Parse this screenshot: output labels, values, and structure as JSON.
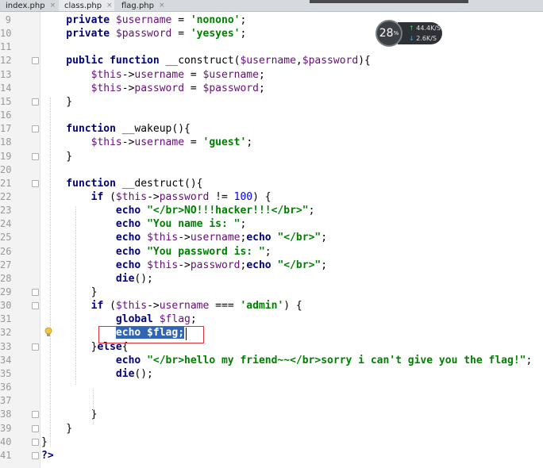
{
  "tabs": [
    {
      "label": "index.php",
      "active": false
    },
    {
      "label": "class.php",
      "active": true
    },
    {
      "label": "flag.php",
      "active": false
    }
  ],
  "close_glyph": "×",
  "widget": {
    "cpu": "28",
    "cpu_unit": "%",
    "up_arrow": "↑",
    "up_speed": "44.4",
    "up_unit": "K/S",
    "down_arrow": "↓",
    "down_speed": "2.6",
    "down_unit": "K/S"
  },
  "colors": {
    "keyword": "#000080",
    "variable": "#660e7a",
    "string": "#008000",
    "number": "#0000ff",
    "selection": "#2f64b6",
    "highlight_box": "#e0303a"
  },
  "lines": [
    {
      "n": "9",
      "segs": [
        [
          "k",
          "    private "
        ],
        [
          "v",
          "$username"
        ],
        [
          "p",
          " = "
        ],
        [
          "s",
          "'nonono'"
        ],
        [
          "p",
          ";"
        ]
      ]
    },
    {
      "n": "10",
      "segs": [
        [
          "k",
          "    private "
        ],
        [
          "v",
          "$password"
        ],
        [
          "p",
          " = "
        ],
        [
          "s",
          "'yesyes'"
        ],
        [
          "p",
          ";"
        ]
      ]
    },
    {
      "n": "11",
      "segs": []
    },
    {
      "n": "12",
      "segs": [
        [
          "k",
          "    public function "
        ],
        [
          "p",
          "__construct("
        ],
        [
          "v",
          "$username"
        ],
        [
          "p",
          ","
        ],
        [
          "v",
          "$password"
        ],
        [
          "p",
          "){"
        ]
      ]
    },
    {
      "n": "13",
      "segs": [
        [
          "v",
          "        $this"
        ],
        [
          "p",
          "->"
        ],
        [
          "v",
          "username"
        ],
        [
          "p",
          " = "
        ],
        [
          "v",
          "$username"
        ],
        [
          "p",
          ";"
        ]
      ]
    },
    {
      "n": "14",
      "segs": [
        [
          "v",
          "        $this"
        ],
        [
          "p",
          "->"
        ],
        [
          "v",
          "password"
        ],
        [
          "p",
          " = "
        ],
        [
          "v",
          "$password"
        ],
        [
          "p",
          ";"
        ]
      ]
    },
    {
      "n": "15",
      "segs": [
        [
          "p",
          "    }"
        ]
      ]
    },
    {
      "n": "16",
      "segs": []
    },
    {
      "n": "17",
      "segs": [
        [
          "k",
          "    function "
        ],
        [
          "p",
          "__wakeup(){"
        ]
      ]
    },
    {
      "n": "18",
      "segs": [
        [
          "v",
          "        $this"
        ],
        [
          "p",
          "->"
        ],
        [
          "v",
          "username"
        ],
        [
          "p",
          " = "
        ],
        [
          "s",
          "'guest'"
        ],
        [
          "p",
          ";"
        ]
      ]
    },
    {
      "n": "19",
      "segs": [
        [
          "p",
          "    }"
        ]
      ]
    },
    {
      "n": "20",
      "segs": []
    },
    {
      "n": "21",
      "segs": [
        [
          "k",
          "    function "
        ],
        [
          "p",
          "__destruct(){"
        ]
      ]
    },
    {
      "n": "22",
      "segs": [
        [
          "k",
          "        if "
        ],
        [
          "p",
          "("
        ],
        [
          "v",
          "$this"
        ],
        [
          "p",
          "->"
        ],
        [
          "v",
          "password"
        ],
        [
          "p",
          " != "
        ],
        [
          "n",
          "100"
        ],
        [
          "p",
          ") {"
        ]
      ]
    },
    {
      "n": "23",
      "segs": [
        [
          "k",
          "            echo "
        ],
        [
          "s",
          "\"</br>NO!!!hacker!!!</br>\""
        ],
        [
          "p",
          ";"
        ]
      ]
    },
    {
      "n": "24",
      "segs": [
        [
          "k",
          "            echo "
        ],
        [
          "s",
          "\"You name is: \""
        ],
        [
          "p",
          ";"
        ]
      ]
    },
    {
      "n": "25",
      "segs": [
        [
          "k",
          "            echo "
        ],
        [
          "v",
          "$this"
        ],
        [
          "p",
          "->"
        ],
        [
          "v",
          "username"
        ],
        [
          "p",
          ";"
        ],
        [
          "k",
          "echo "
        ],
        [
          "s",
          "\"</br>\""
        ],
        [
          "p",
          ";"
        ]
      ]
    },
    {
      "n": "26",
      "segs": [
        [
          "k",
          "            echo "
        ],
        [
          "s",
          "\"You password is: \""
        ],
        [
          "p",
          ";"
        ]
      ]
    },
    {
      "n": "27",
      "segs": [
        [
          "k",
          "            echo "
        ],
        [
          "v",
          "$this"
        ],
        [
          "p",
          "->"
        ],
        [
          "v",
          "password"
        ],
        [
          "p",
          ";"
        ],
        [
          "k",
          "echo "
        ],
        [
          "s",
          "\"</br>\""
        ],
        [
          "p",
          ";"
        ]
      ]
    },
    {
      "n": "28",
      "segs": [
        [
          "k",
          "            die"
        ],
        [
          "p",
          "();"
        ]
      ]
    },
    {
      "n": "29",
      "segs": [
        [
          "p",
          "        }"
        ]
      ]
    },
    {
      "n": "30",
      "segs": [
        [
          "k",
          "        if "
        ],
        [
          "p",
          "("
        ],
        [
          "v",
          "$this"
        ],
        [
          "p",
          "->"
        ],
        [
          "v",
          "username"
        ],
        [
          "p",
          " === "
        ],
        [
          "s",
          "'admin'"
        ],
        [
          "p",
          ") {"
        ]
      ]
    },
    {
      "n": "31",
      "segs": [
        [
          "k",
          "            global "
        ],
        [
          "v",
          "$flag"
        ],
        [
          "p",
          ";"
        ]
      ]
    },
    {
      "n": "32",
      "segs": [
        [
          "p",
          "            "
        ],
        [
          "hl",
          "echo $flag;"
        ]
      ]
    },
    {
      "n": "33",
      "segs": [
        [
          "p",
          "        }"
        ],
        [
          "k",
          "else"
        ],
        [
          "p",
          "{"
        ]
      ]
    },
    {
      "n": "34",
      "segs": [
        [
          "k",
          "            echo "
        ],
        [
          "s",
          "\"</br>hello my friend~~</br>sorry i can't give you the flag!\""
        ],
        [
          "p",
          ";"
        ]
      ]
    },
    {
      "n": "35",
      "segs": [
        [
          "k",
          "            die"
        ],
        [
          "p",
          "();"
        ]
      ]
    },
    {
      "n": "36",
      "segs": []
    },
    {
      "n": "37",
      "segs": []
    },
    {
      "n": "38",
      "segs": [
        [
          "p",
          "        }"
        ]
      ]
    },
    {
      "n": "39",
      "segs": [
        [
          "p",
          "    }"
        ]
      ]
    },
    {
      "n": "40",
      "segs": [
        [
          "p",
          "}"
        ]
      ]
    },
    {
      "n": "41",
      "segs": [
        [
          "k",
          "?>"
        ]
      ]
    }
  ]
}
